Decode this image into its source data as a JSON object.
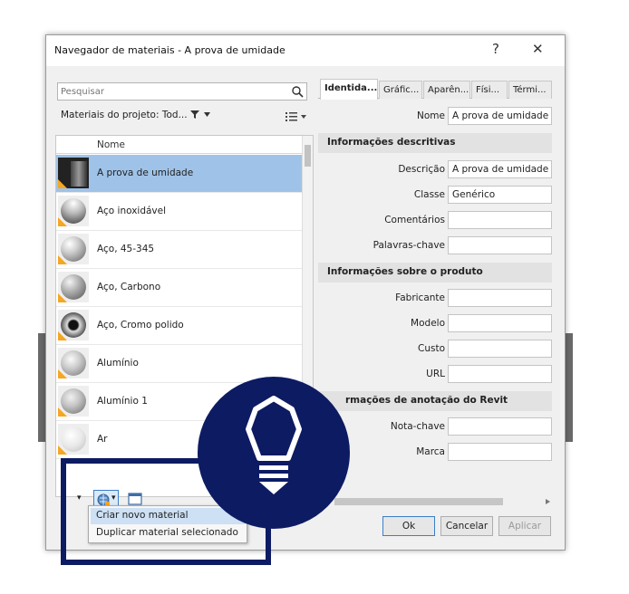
{
  "window": {
    "title": "Navegador de materiais - A prova de umidade",
    "help_glyph": "?",
    "close_glyph": "✕"
  },
  "left_panel": {
    "search_placeholder": "Pesquisar",
    "filter_label": "Materiais do projeto: Tod... ",
    "filter_icon": "funnel-icon",
    "view_icon": "list-view-icon",
    "column_header": "Nome",
    "materials": [
      {
        "label": "A prova de umidade",
        "selected": true
      },
      {
        "label": "Aço inoxidável",
        "selected": false
      },
      {
        "label": "Aço, 45-345",
        "selected": false
      },
      {
        "label": "Aço, Carbono",
        "selected": false
      },
      {
        "label": "Aço, Cromo polido",
        "selected": false
      },
      {
        "label": "Alumínio",
        "selected": false
      },
      {
        "label": "Alumínio 1",
        "selected": false
      },
      {
        "label": "Ar",
        "selected": false
      }
    ]
  },
  "tabs": [
    {
      "label": "Identida...",
      "active": true
    },
    {
      "label": "Gráfic...",
      "active": false
    },
    {
      "label": "Aparên...",
      "active": false
    },
    {
      "label": "Físi...",
      "active": false
    },
    {
      "label": "Térmi...",
      "active": false
    }
  ],
  "properties": {
    "name_label": "Nome",
    "name_value": "A prova de umidade",
    "section_descriptive": "Informações descritivas",
    "description_label": "Descrição",
    "description_value": "A prova de umidade",
    "class_label": "Classe",
    "class_value": "Genérico",
    "comments_label": "Comentários",
    "keywords_label": "Palavras-chave",
    "section_product": "Informações sobre o produto",
    "manufacturer_label": "Fabricante",
    "model_label": "Modelo",
    "cost_label": "Custo",
    "url_label": "URL",
    "section_revit": "rmações de anotação do Revit",
    "keynote_label": "Nota-chave",
    "mark_label": "Marca"
  },
  "buttons": {
    "ok": "Ok",
    "cancel": "Cancelar",
    "apply": "Aplicar"
  },
  "dropdown": {
    "items": [
      "Criar novo material",
      "Duplicar material selecionado"
    ]
  },
  "colors": {
    "navy": "#0d1b63",
    "selection": "#9fc3e8",
    "accent_orange": "#f5a623"
  }
}
